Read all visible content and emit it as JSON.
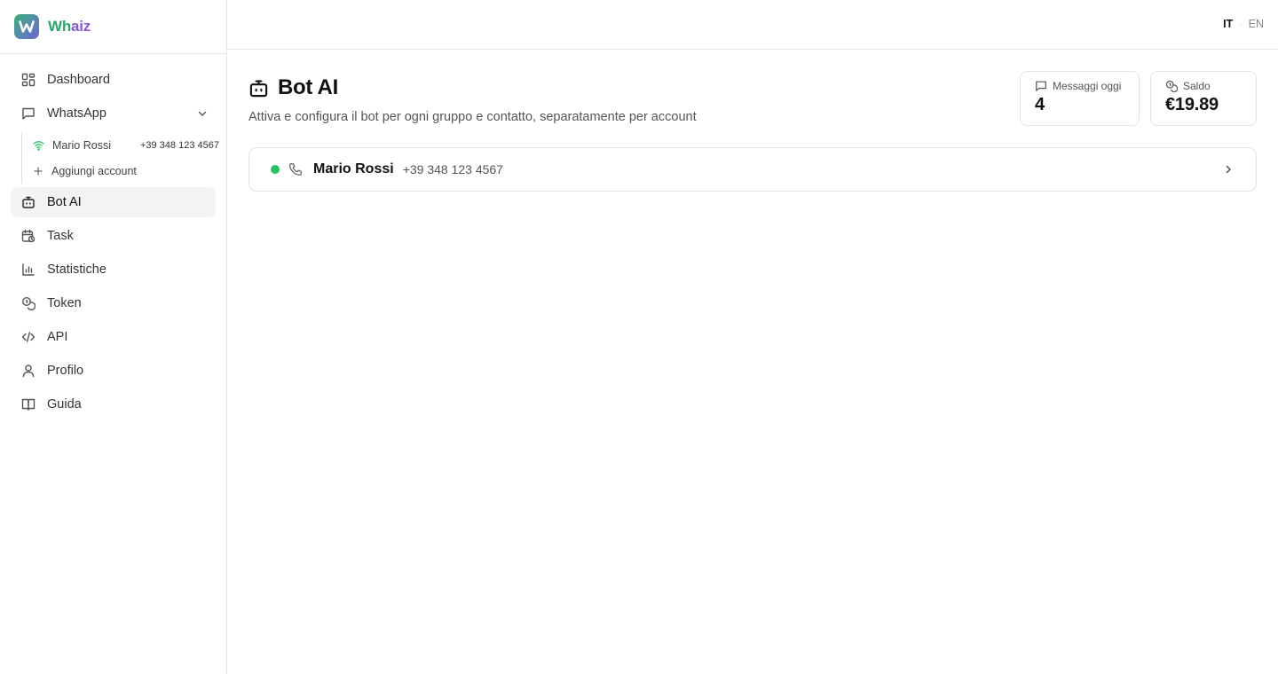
{
  "brand": {
    "name_part1": "Wh",
    "name_part2": "aiz",
    "colors": {
      "green": "#27a86b",
      "purple": "#8b58d8"
    }
  },
  "sidebar": {
    "items": [
      {
        "label": "Dashboard",
        "icon": "dashboard-icon"
      },
      {
        "label": "WhatsApp",
        "icon": "chat-icon",
        "expanded": true
      },
      {
        "label": "Bot AI",
        "icon": "bot-icon",
        "active": true
      },
      {
        "label": "Task",
        "icon": "calendar-clock-icon"
      },
      {
        "label": "Statistiche",
        "icon": "bar-chart-icon"
      },
      {
        "label": "Token",
        "icon": "coins-icon"
      },
      {
        "label": "API",
        "icon": "code-icon"
      },
      {
        "label": "Profilo",
        "icon": "user-icon"
      },
      {
        "label": "Guida",
        "icon": "book-icon"
      }
    ],
    "whatsapp_sub": {
      "account": {
        "name": "Mario Rossi",
        "phone": "+39 348 123 4567",
        "icon": "wifi-icon"
      },
      "add": {
        "label": "Aggiungi account",
        "icon": "plus-icon"
      }
    }
  },
  "topbar": {
    "lang_it": "IT",
    "lang_sep": "·",
    "lang_en": "EN",
    "active_lang": "IT"
  },
  "main": {
    "title": "Bot AI",
    "subtitle": "Attiva e configura il bot per ogni gruppo e contatto, separatamente per account",
    "stats": {
      "messages": {
        "label": "Messaggi oggi",
        "value": "4",
        "icon": "message-icon"
      },
      "balance": {
        "label": "Saldo",
        "value": "€19.89",
        "icon": "coins-icon"
      }
    },
    "account": {
      "name": "Mario Rossi",
      "phone": "+39 348 123 4567",
      "status_color": "#22c55e",
      "status": "online"
    }
  }
}
